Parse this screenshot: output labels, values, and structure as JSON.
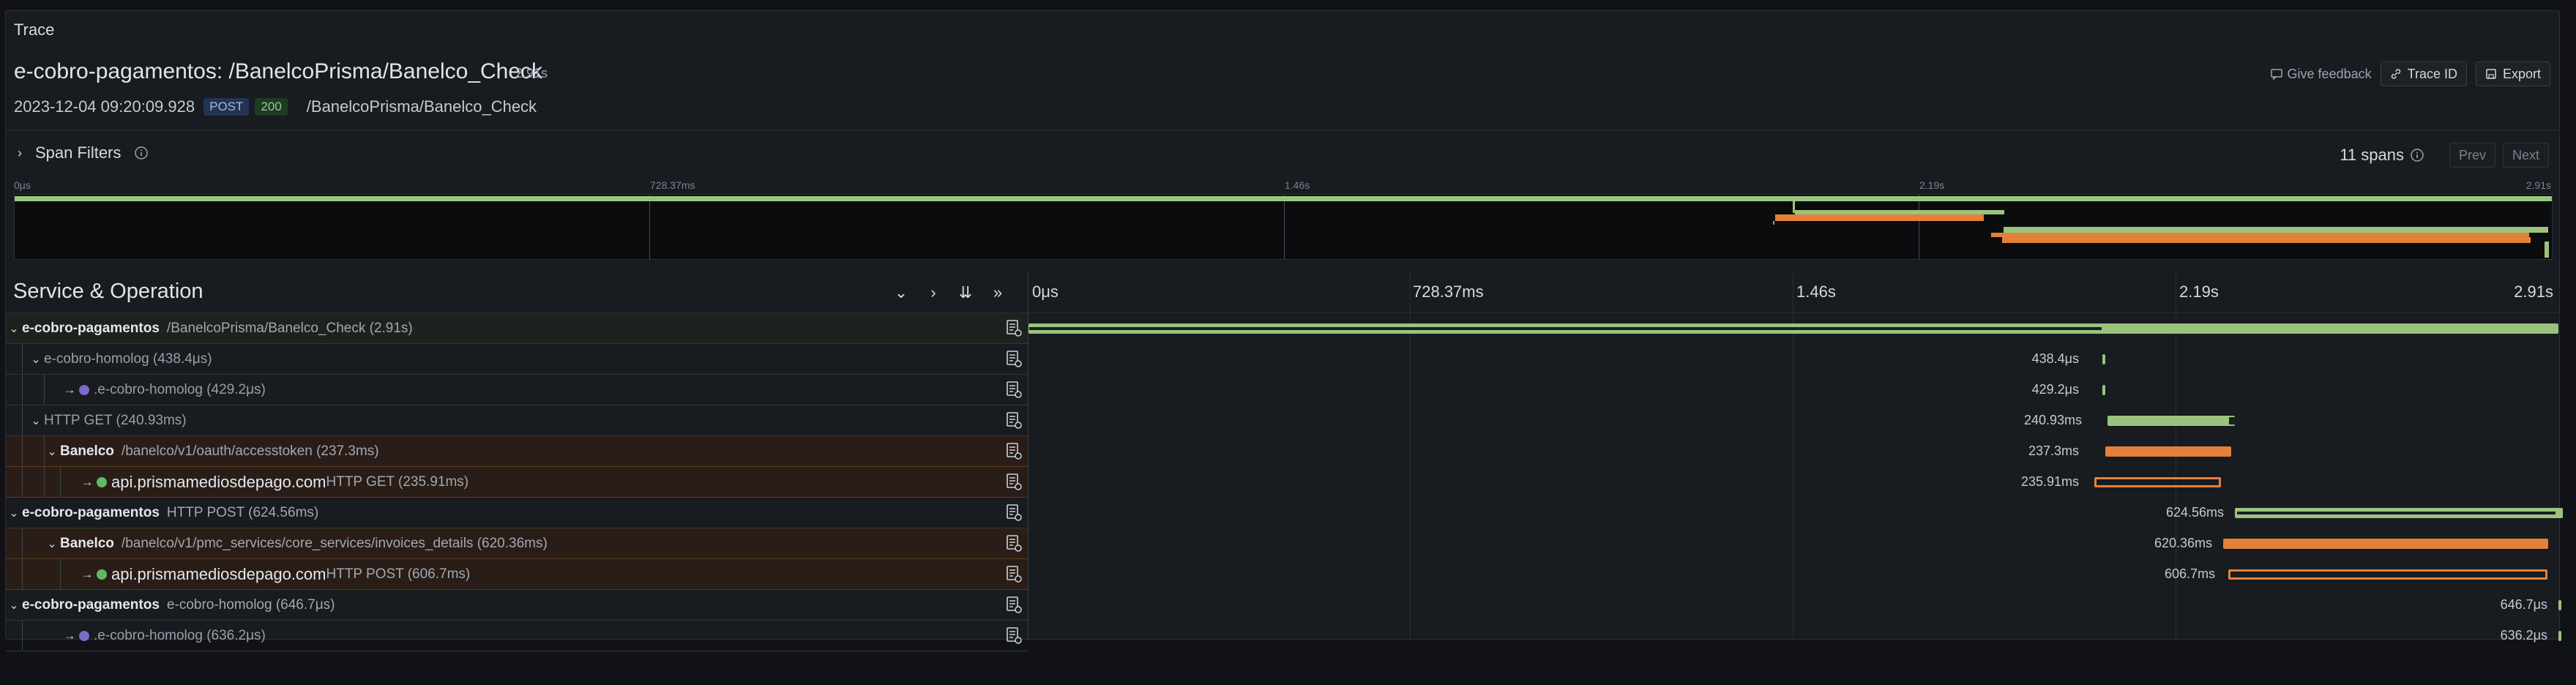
{
  "panel": {
    "title": "Trace"
  },
  "trace": {
    "title": "e-cobro-pagamentos: /BanelcoPrisma/Banelco_Check",
    "duration": "2.91s",
    "start": "2023-12-04 09:20:09.928",
    "method": "POST",
    "status": "200",
    "url": "/BanelcoPrisma/Banelco_Check"
  },
  "actions": {
    "feedback": "Give feedback",
    "trace_id": "Trace ID",
    "export": "Export"
  },
  "filters": {
    "label": "Span Filters",
    "count": "11 spans",
    "prev": "Prev",
    "next": "Next"
  },
  "minimap": {
    "ticks": [
      "0μs",
      "728.37ms",
      "1.46s",
      "2.19s",
      "2.91s"
    ]
  },
  "timeline": {
    "header": "Service & Operation",
    "ticks": [
      "0μs",
      "728.37ms",
      "1.46s",
      "2.19s",
      "2.91s"
    ]
  },
  "rows": [
    {
      "service": "e-cobro-pagamentos",
      "operation": "/BanelcoPrisma/Banelco_Check (2.91s)",
      "label": ""
    },
    {
      "service": "e-cobro-homolog (438.4μs)",
      "operation": "",
      "label": "438.4μs"
    },
    {
      "service": ".e-cobro-homolog (429.2μs)",
      "operation": "",
      "label": "429.2μs"
    },
    {
      "service": "HTTP GET (240.93ms)",
      "operation": "",
      "label": "240.93ms"
    },
    {
      "service": "Banelco",
      "operation": "/banelco/v1/oauth/accesstoken (237.3ms)",
      "label": "237.3ms"
    },
    {
      "service": "api.prismamediosdepago.com",
      "operation": "HTTP GET (235.91ms)",
      "label": "235.91ms"
    },
    {
      "service": "e-cobro-pagamentos",
      "operation": "HTTP POST (624.56ms)",
      "label": "624.56ms"
    },
    {
      "service": "Banelco",
      "operation": "/banelco/v1/pmc_services/core_services/invoices_details (620.36ms)",
      "label": "620.36ms"
    },
    {
      "service": "api.prismamediosdepago.com",
      "operation": "HTTP POST (606.7ms)",
      "label": "606.7ms"
    },
    {
      "service": "e-cobro-pagamentos",
      "operation": "e-cobro-homolog (646.7μs)",
      "label": "646.7μs"
    },
    {
      "service": ".e-cobro-homolog (636.2μs)",
      "operation": "",
      "label": "636.2μs"
    }
  ],
  "colors": {
    "green": "#9ac47e",
    "orange": "#e5803a",
    "purple": "#7b6bc6",
    "green_dot": "#5dbb63"
  },
  "icons": [
    "chevron-down-icon",
    "chevron-right-icon",
    "expand-all-icon",
    "expand-one-icon",
    "info-icon",
    "span-detail-icon"
  ]
}
